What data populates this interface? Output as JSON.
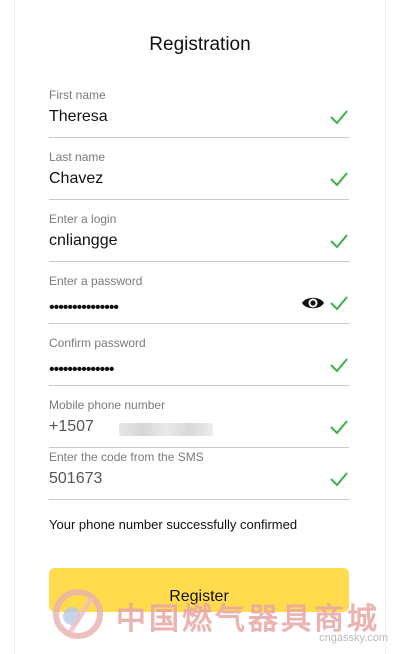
{
  "title": "Registration",
  "fields": {
    "first_name": {
      "label": "First name",
      "value": "Theresa"
    },
    "last_name": {
      "label": "Last name",
      "value": "Chavez"
    },
    "login": {
      "label": "Enter a login",
      "value": "cnliangge"
    },
    "password": {
      "label": "Enter a password",
      "value": "•••••••••••••••"
    },
    "confirm": {
      "label": "Confirm password",
      "value": "••••••••••••••"
    },
    "phone": {
      "label": "Mobile phone number",
      "value": "+1507"
    },
    "sms": {
      "label": "Enter the code from the SMS",
      "value": "501673"
    }
  },
  "status_message": "Your phone number successfully confirmed",
  "register_label": "Register",
  "watermark": {
    "text": "中国燃气器具商城",
    "url": "cngassky.com"
  },
  "icons": {
    "check": "check-icon",
    "eye": "eye-icon"
  },
  "colors": {
    "check": "#3bb34a",
    "button": "#ffdb4d"
  }
}
